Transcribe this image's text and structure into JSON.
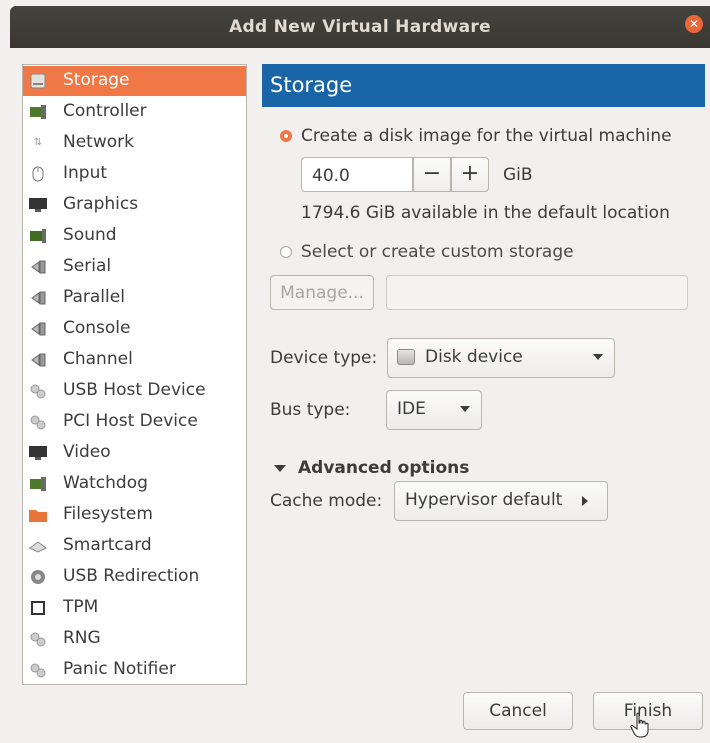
{
  "window": {
    "title": "Add New Virtual Hardware"
  },
  "sidebar": {
    "items": [
      {
        "label": "Storage",
        "icon": "storage-icon",
        "selected": true
      },
      {
        "label": "Controller",
        "icon": "controller-icon"
      },
      {
        "label": "Network",
        "icon": "network-icon"
      },
      {
        "label": "Input",
        "icon": "mouse-icon"
      },
      {
        "label": "Graphics",
        "icon": "monitor-icon"
      },
      {
        "label": "Sound",
        "icon": "sound-card-icon"
      },
      {
        "label": "Serial",
        "icon": "serial-port-icon"
      },
      {
        "label": "Parallel",
        "icon": "parallel-port-icon"
      },
      {
        "label": "Console",
        "icon": "console-port-icon"
      },
      {
        "label": "Channel",
        "icon": "channel-port-icon"
      },
      {
        "label": "USB Host Device",
        "icon": "usb-host-icon"
      },
      {
        "label": "PCI Host Device",
        "icon": "pci-host-icon"
      },
      {
        "label": "Video",
        "icon": "video-icon"
      },
      {
        "label": "Watchdog",
        "icon": "watchdog-icon"
      },
      {
        "label": "Filesystem",
        "icon": "folder-icon"
      },
      {
        "label": "Smartcard",
        "icon": "smartcard-icon"
      },
      {
        "label": "USB Redirection",
        "icon": "usb-redirection-icon"
      },
      {
        "label": "TPM",
        "icon": "tpm-chip-icon"
      },
      {
        "label": "RNG",
        "icon": "rng-icon"
      },
      {
        "label": "Panic Notifier",
        "icon": "panic-notifier-icon"
      }
    ]
  },
  "storage": {
    "header": "Storage",
    "create_disk_label": "Create a disk image for the virtual machine",
    "create_disk_selected": true,
    "size_value": "40.0",
    "size_unit": "GiB",
    "minus_label": "−",
    "plus_label": "+",
    "available_text": "1794.6 GiB available in the default location",
    "custom_storage_label": "Select or create custom storage",
    "manage_button": "Manage...",
    "device_type_label": "Device type:",
    "device_type_value": "Disk device",
    "bus_type_label": "Bus type:",
    "bus_type_value": "IDE",
    "advanced_label": "Advanced options",
    "cache_mode_label": "Cache mode:",
    "cache_mode_value": "Hypervisor default"
  },
  "footer": {
    "cancel_label": "Cancel",
    "finish_label": "Finish"
  },
  "colors": {
    "accent": "#f07746",
    "header": "#1a64a8",
    "titlebar": "#3f3d37"
  }
}
